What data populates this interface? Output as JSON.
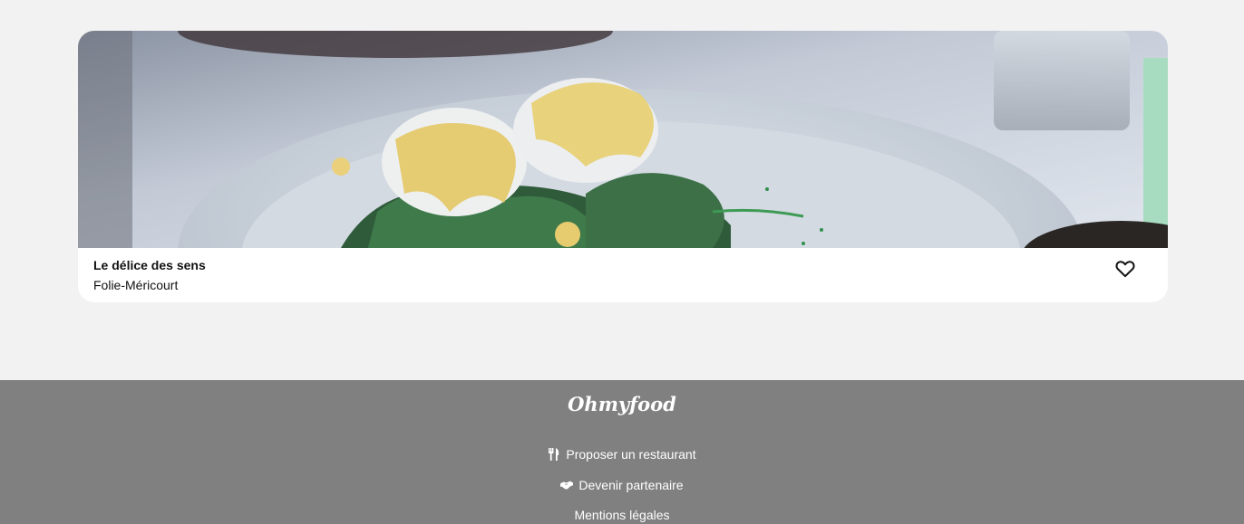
{
  "restaurant": {
    "name": "Le délice des sens",
    "area": "Folie-Méricourt",
    "favorite_icon": "heart-outline-icon"
  },
  "footer": {
    "logo": "Ohmyfood",
    "links": [
      {
        "label": "Proposer un restaurant",
        "icon": "utensils-icon"
      },
      {
        "label": "Devenir partenaire",
        "icon": "handshake-icon"
      },
      {
        "label": "Mentions légales",
        "icon": ""
      }
    ]
  },
  "colors": {
    "page_bg": "#f2f2f2",
    "card_bg": "#ffffff",
    "footer_bg": "#808080"
  }
}
